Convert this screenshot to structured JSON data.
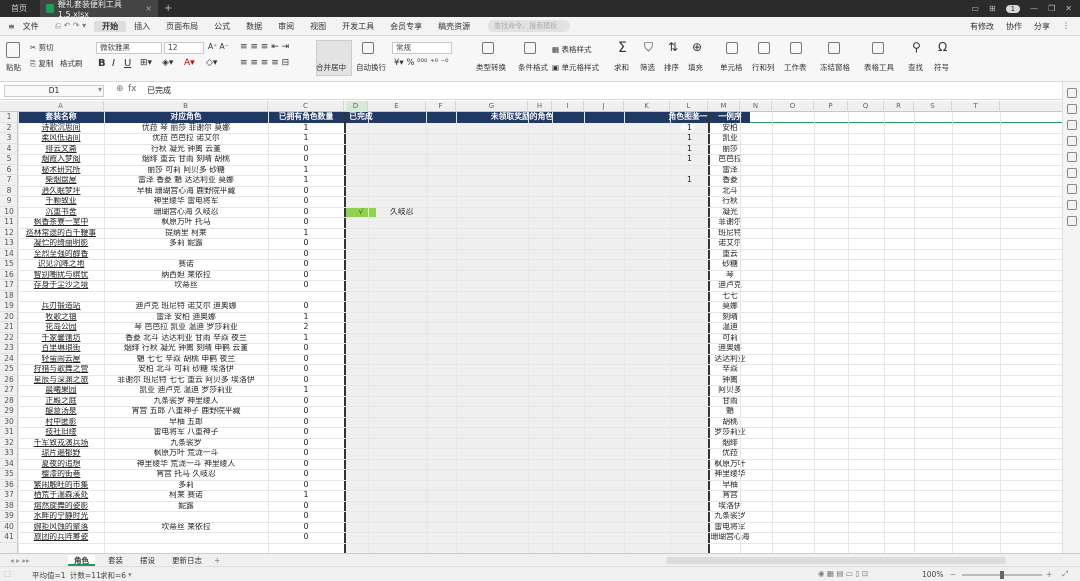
{
  "titlebar": {
    "home": "首页",
    "file_tab": "鞭礼套装便利工具1.5.xlsx",
    "badge": "1"
  },
  "menu": {
    "file": "文件",
    "items": [
      "开始",
      "插入",
      "页面布局",
      "公式",
      "数据",
      "审阅",
      "视图",
      "开发工具",
      "会员专享",
      "稿壳资源"
    ],
    "search_placeholder": "查找命令、搜索模板",
    "right": [
      "有修改",
      "协作",
      "分享"
    ]
  },
  "ribbon": {
    "paste": "粘贴",
    "cut": "剪切",
    "copy": "复制",
    "format_painter": "格式刷",
    "font": "微软雅黑",
    "font_size": "12",
    "merge": "合并居中",
    "wrap": "自动换行",
    "number_format": "常规",
    "type_convert": "类型转换",
    "cond_format": "条件格式",
    "table_style": "表格样式",
    "cell_style": "单元格样式",
    "sum": "求和",
    "filter": "筛选",
    "sort": "排序",
    "fill": "填充",
    "cell": "单元格",
    "rowcol": "行和列",
    "sheet": "工作表",
    "freeze": "冻结窗格",
    "table_tools": "表格工具",
    "find": "查找",
    "symbol": "符号"
  },
  "formula_bar": {
    "cell_ref": "D1",
    "fx": "fx",
    "content": "已完成"
  },
  "columns": [
    "A",
    "B",
    "C",
    "D",
    "E",
    "F",
    "G",
    "H",
    "I",
    "J",
    "K",
    "L",
    "M",
    "N",
    "O",
    "P",
    "Q",
    "R",
    "S",
    "T"
  ],
  "header_row": {
    "a": "套装名称",
    "b": "对应角色",
    "c": "已拥有角色数量",
    "d": "已完成",
    "eg": "未领取奖励的角色",
    "l": "角色图鉴一例序",
    "m": "一例序"
  },
  "rows": [
    {
      "n": "2",
      "a": "诗歌沉思间",
      "b": "优菈 琴 丽莎 菲谢尔 莫娜",
      "c": "1",
      "l": "1",
      "m": "安柏"
    },
    {
      "n": "3",
      "a": "柔风低语间",
      "b": "优菈 芭芭拉 诺艾尔",
      "c": "1",
      "l": "1",
      "m": "凯亚"
    },
    {
      "n": "4",
      "a": "排云文斋",
      "b": "行秋 凝光 钟离 云堇",
      "c": "0",
      "l": "1",
      "m": "丽莎"
    },
    {
      "n": "5",
      "a": "烟霞入梦阁",
      "b": "烟绯 重云 甘雨 刻晴 胡桃",
      "c": "0",
      "l": "1",
      "m": "芭芭拉"
    },
    {
      "n": "6",
      "a": "秘术研究所",
      "b": "丽莎 可莉 阿贝多 砂糖",
      "c": "1",
      "l": "",
      "m": "雷泽"
    },
    {
      "n": "7",
      "a": "柴烟盘屋",
      "b": "雷泽 香菱 魈 达达利亚 莫娜",
      "c": "1",
      "l": "1",
      "m": "香菱"
    },
    {
      "n": "8",
      "a": "逍久眠梦坪",
      "b": "早柚 珊瑚宫心海 鹿野院平藏",
      "c": "0",
      "l": "",
      "m": "北斗"
    },
    {
      "n": "9",
      "a": "千颗致业",
      "b": "神里绫华 雷电将军",
      "c": "0",
      "l": "",
      "m": "行秋"
    },
    {
      "n": "10",
      "a": "沉重书舍",
      "b": "珊瑚宫心海 久岐忍",
      "c": "0",
      "l": "",
      "m": "凝光",
      "d": "√",
      "e": "久岐忍"
    },
    {
      "n": "11",
      "a": "枫香茶寮一室中",
      "b": "枫原万叶 托马",
      "c": "0",
      "l": "",
      "m": "菲谢尔"
    },
    {
      "n": "12",
      "a": "巡林常途的百千鞭事",
      "b": "提纳里 柯莱",
      "c": "1",
      "l": "",
      "m": "班尼特"
    },
    {
      "n": "13",
      "a": "凝伫的绮丽明影",
      "b": "多莉 妮露",
      "c": "0",
      "l": "",
      "m": "诺艾尔"
    },
    {
      "n": "14",
      "a": "至烈至强的醇香",
      "b": "",
      "c": "0",
      "l": "",
      "m": "重云"
    },
    {
      "n": "15",
      "a": "识见沉降之地",
      "b": "赛诺",
      "c": "0",
      "l": "",
      "m": "砂糖"
    },
    {
      "n": "16",
      "a": "智别嘲扰与缤忧",
      "b": "纳西妲 莱依拉",
      "c": "0",
      "l": "",
      "m": "琴"
    },
    {
      "n": "17",
      "a": "存身于尘沙之境",
      "b": "坎蒂丝",
      "c": "0",
      "l": "",
      "m": "迪卢克"
    },
    {
      "n": "18",
      "a": "",
      "b": "",
      "c": "",
      "l": "",
      "m": "七七"
    },
    {
      "n": "19",
      "a": "兵刃锻造站",
      "b": "迪卢克 班尼特 诺艾尔 迪奥娜",
      "c": "0",
      "l": "",
      "m": "莫娜"
    },
    {
      "n": "20",
      "a": "牧歌之镇",
      "b": "雷泽 安柏 迪奥娜",
      "c": "1",
      "l": "",
      "m": "刻晴"
    },
    {
      "n": "21",
      "a": "花岛公园",
      "b": "琴 芭芭拉 凯亚 温迪 罗莎莉亚",
      "c": "2",
      "l": "",
      "m": "温迪"
    },
    {
      "n": "22",
      "a": "千家馨馐坊",
      "b": "香菱 北斗 达达利亚 甘雨 辛焱 夜兰",
      "c": "1",
      "l": "",
      "m": "可莉"
    },
    {
      "n": "23",
      "a": "百里琳琅街",
      "b": "烟绯 行秋 凝光 钟离 刻晴 申鹤 云堇",
      "c": "0",
      "l": "",
      "m": "迪奥娜"
    },
    {
      "n": "24",
      "a": "轻萤闹云屋",
      "b": "魈 七七 辛焱 胡桃 申鹤 夜兰",
      "c": "0",
      "l": "",
      "m": "达达利亚"
    },
    {
      "n": "25",
      "a": "狩猎与歌舞之营",
      "b": "安柏 北斗 可莉 砂糖 埃洛伊",
      "c": "0",
      "l": "",
      "m": "辛焱"
    },
    {
      "n": "26",
      "a": "星辰与深渊之旅",
      "b": "菲谢尔 班尼特 七七 重云 阿贝多 埃洛伊",
      "c": "0",
      "l": "",
      "m": "钟离"
    },
    {
      "n": "27",
      "a": "晨曦果园",
      "b": "凯亚 迪卢克 温迪 罗莎莉亚",
      "c": "1",
      "l": "",
      "m": "阿贝多"
    },
    {
      "n": "28",
      "a": "正殿之庭",
      "b": "九条裟罗 神里绫人",
      "c": "0",
      "l": "",
      "m": "甘雨"
    },
    {
      "n": "29",
      "a": "醍意汤泉",
      "b": "宵宫 五郎 八重神子 鹿野院平藏",
      "c": "0",
      "l": "",
      "m": "魈"
    },
    {
      "n": "30",
      "a": "村中匿影",
      "b": "早柚 五郎",
      "c": "0",
      "l": "",
      "m": "胡桃"
    },
    {
      "n": "31",
      "a": "技社旧缕",
      "b": "雷电将军 八重神子",
      "c": "0",
      "l": "",
      "m": "罗莎莉亚"
    },
    {
      "n": "32",
      "a": "千军致戎演兵场",
      "b": "九条裟罗",
      "c": "0",
      "l": "",
      "m": "烟绯"
    },
    {
      "n": "33",
      "a": "琼片遍郁野",
      "b": "枫原万叶 荒泷一斗",
      "c": "0",
      "l": "",
      "m": "优菈"
    },
    {
      "n": "34",
      "a": "夏夜的追想",
      "b": "神里绫华 荒泷一斗 神里绫人",
      "c": "0",
      "l": "",
      "m": "枫原万叶"
    },
    {
      "n": "35",
      "a": "樱漆的街巷",
      "b": "宵宫 托马 久岐忍",
      "c": "0",
      "l": "",
      "m": "神里绫华"
    },
    {
      "n": "36",
      "a": "繁闹触旺的市集",
      "b": "多莉",
      "c": "0",
      "l": "",
      "m": "早柚"
    },
    {
      "n": "37",
      "a": "栖荒于湍森溪处",
      "b": "柯莱 赛诺",
      "c": "1",
      "l": "",
      "m": "宵宫"
    },
    {
      "n": "38",
      "a": "熔然旋舞的姿影",
      "b": "妮露",
      "c": "0",
      "l": "",
      "m": "埃洛伊"
    },
    {
      "n": "39",
      "a": "水畔的宁静时光",
      "b": "",
      "c": "0",
      "l": "",
      "m": "九条裟罗"
    },
    {
      "n": "40",
      "a": "婉拒风蚀的聚落",
      "b": "坎蒂丝 莱依拉",
      "c": "0",
      "l": "",
      "m": "雷电将军"
    },
    {
      "n": "41",
      "a": "旅团的兵阵筹姿",
      "b": "",
      "c": "0",
      "l": "",
      "m": "珊瑚宫心海"
    }
  ],
  "sheet_tabs": [
    "角色",
    "套装",
    "摆设",
    "更新日志"
  ],
  "status": {
    "avg": "平均值=1",
    "count": "计数=11",
    "sum": "求和=6",
    "zoom": "100%"
  },
  "colors": {
    "header_bg": "#1f3864",
    "accent": "#1e9e5a",
    "check_bg": "#92d050"
  }
}
